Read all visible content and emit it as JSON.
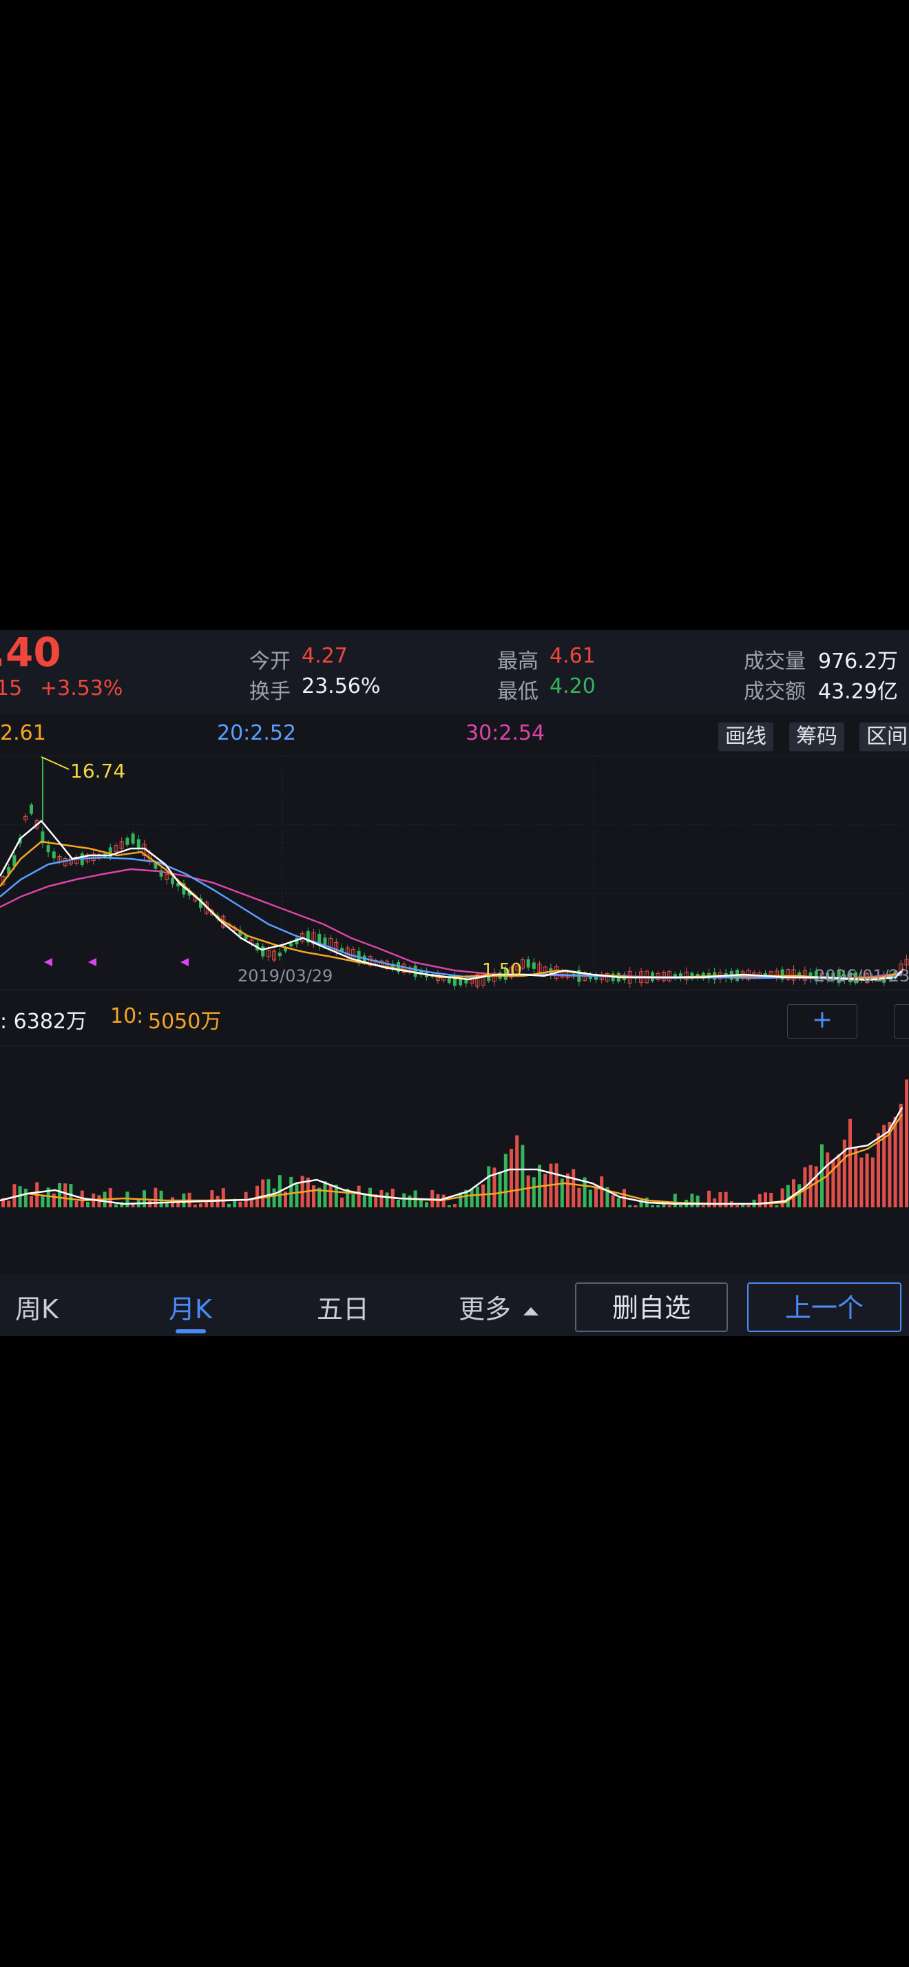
{
  "quote": {
    "price": ".40",
    "change": "15",
    "change_pct": "+3.53%",
    "open_label": "今开",
    "open": "4.27",
    "turnover_label": "换手",
    "turnover": "23.56%",
    "high_label": "最高",
    "high": "4.61",
    "low_label": "最低",
    "low": "4.20",
    "volume_label": "成交量",
    "volume": "976.2万",
    "amount_label": "成交额",
    "amount": "43.29亿"
  },
  "ma": {
    "ma10": "2.61",
    "ma20": "20:2.52",
    "ma30": "30:2.54"
  },
  "tools": {
    "draw": "画线",
    "chips": "筹码",
    "range": "区间"
  },
  "chart_data": {
    "type": "candlestick",
    "annotations": {
      "high_label": "16.74",
      "low_label": "1.50"
    },
    "x_labels": [
      "2019/03/29",
      "2026/01/23"
    ],
    "colors": {
      "up": "#e0504a",
      "down": "#35b45a",
      "ma5": "#ffffff",
      "ma10": "#f5a623",
      "ma20": "#5aa0ff",
      "ma30": "#d946a8"
    }
  },
  "volume": {
    "ma5": ": 6382万",
    "ma10_label": "10: ",
    "ma10": "5050万",
    "add_symbol": "+"
  },
  "tabs": {
    "week": "周K",
    "month": "月K",
    "five_day": "五日",
    "more": "更多"
  },
  "actions": {
    "remove_watch": "删自选",
    "prev": "上一个"
  }
}
